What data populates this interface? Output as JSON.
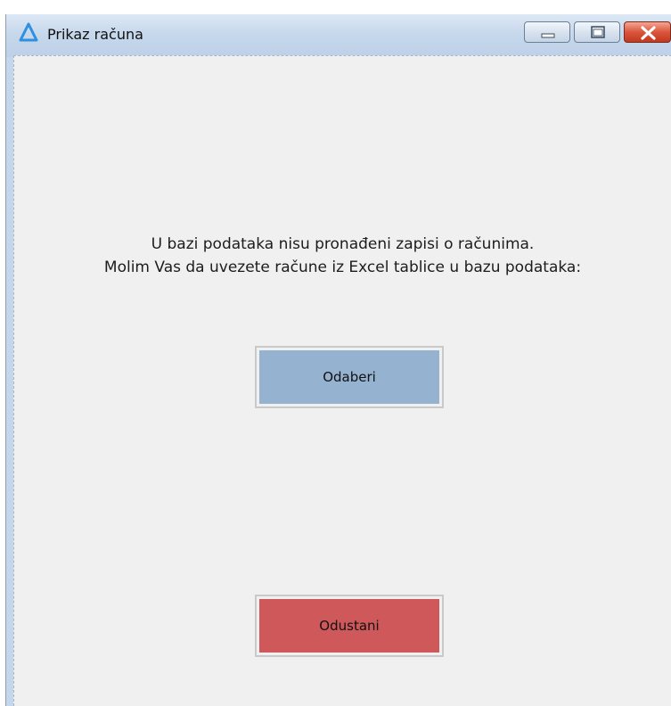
{
  "window": {
    "title": "Prikaz računa",
    "app_icon": "delta-icon",
    "controls": {
      "minimize_icon": "minimize-icon",
      "maximize_icon": "maximize-icon",
      "close_icon": "close-icon"
    }
  },
  "main": {
    "message_line1": "U bazi podataka nisu pronađeni zapisi o računima.",
    "message_line2": "Molim Vas da uvezete račune iz Excel tablice u bazu podataka:",
    "select_button_label": "Odaberi",
    "cancel_button_label": "Odustani"
  },
  "colors": {
    "select_button": "#95b2d0",
    "cancel_button": "#cf595a",
    "background": "#f0f0f0",
    "titlebar": "#c7d8ec",
    "app_icon": "#2f8fe0"
  }
}
